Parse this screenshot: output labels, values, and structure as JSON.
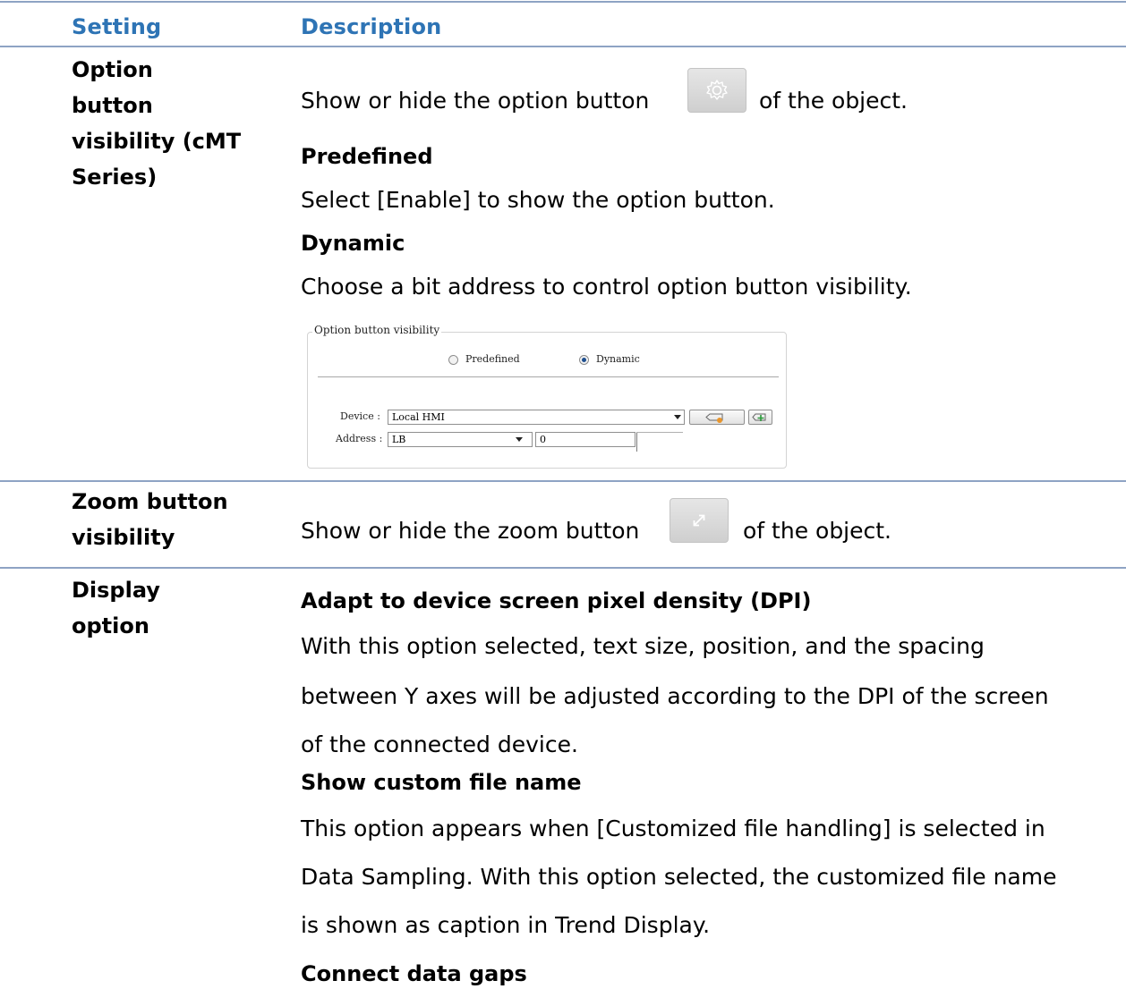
{
  "header": {
    "setting": "Setting",
    "description": "Description"
  },
  "rows": {
    "option_button": {
      "setting_lines": [
        "Option",
        "button",
        "visibility (cMT",
        "Series)"
      ],
      "intro_before": "Show or hide the option button",
      "intro_after": "of the object.",
      "predefined_title": "Predefined",
      "predefined_text": "Select [Enable] to show the option button.",
      "dynamic_title": "Dynamic",
      "dynamic_text": "Choose a bit address to control option button visibility.",
      "icon": "gear-icon"
    },
    "zoom_button": {
      "setting_lines": [
        "Zoom button",
        "visibility"
      ],
      "intro_before": "Show or hide the zoom button",
      "intro_after": "of the object.",
      "icon": "expand-arrows-icon"
    },
    "display_option": {
      "setting_lines": [
        "Display",
        "option"
      ],
      "dpi_title": "Adapt to device screen pixel density (DPI)",
      "dpi_lines": [
        "With this option selected, text size, position, and the spacing",
        "between Y axes will be adjusted according to the DPI of the screen",
        "of the connected device."
      ],
      "custom_title": "Show custom file name",
      "custom_lines": [
        "This option appears when [Customized file handling] is selected in",
        "Data Sampling. With this option selected, the customized file name",
        "is shown as caption in Trend Display."
      ],
      "gaps_title": "Connect data gaps"
    }
  },
  "dialog": {
    "title": "Option button visibility",
    "radio_predefined": "Predefined",
    "radio_dynamic": "Dynamic",
    "selected": "Dynamic",
    "device_label": "Device :",
    "device_value": "Local HMI",
    "address_label": "Address :",
    "address_type": "LB",
    "address_value": "0"
  },
  "colors": {
    "header_text": "#2e74b5",
    "rule": "#8ea3c4"
  }
}
